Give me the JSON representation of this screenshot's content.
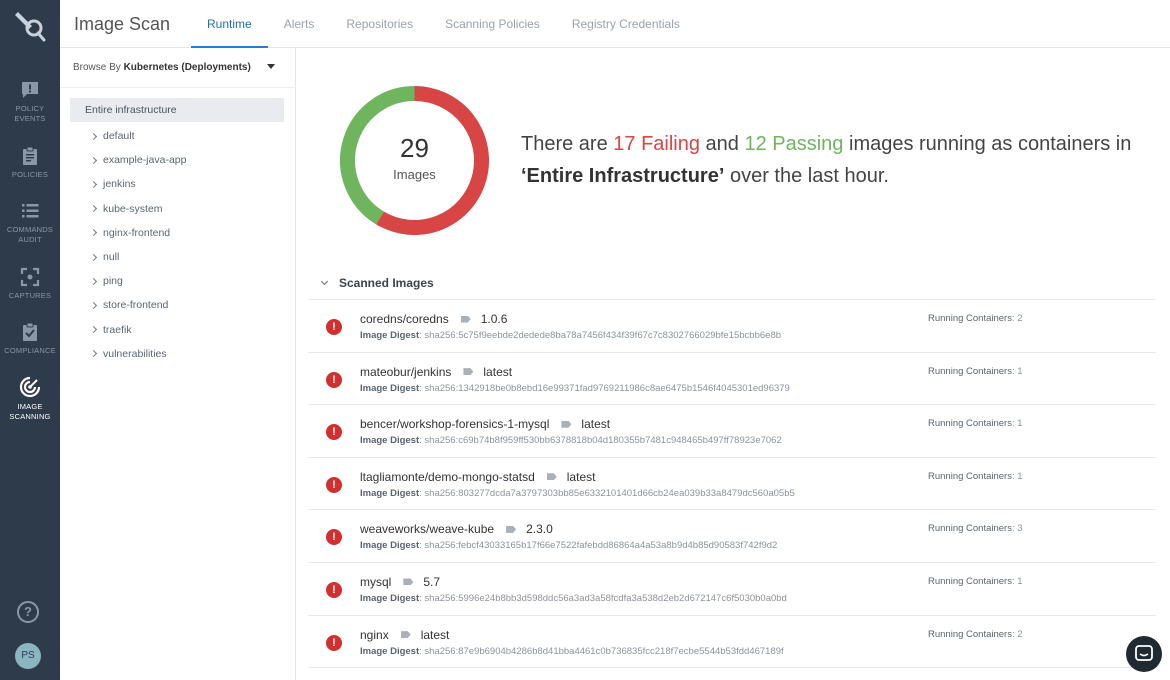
{
  "header": {
    "title": "Image Scan",
    "tabs": [
      "Runtime",
      "Alerts",
      "Repositories",
      "Scanning Policies",
      "Registry Credentials"
    ]
  },
  "leftnav": {
    "items": [
      {
        "label1": "POLICY",
        "label2": "EVENTS",
        "icon": "message-alert-icon"
      },
      {
        "label1": "POLICIES",
        "label2": "",
        "icon": "clipboard-icon"
      },
      {
        "label1": "COMMANDS",
        "label2": "AUDIT",
        "icon": "list-icon"
      },
      {
        "label1": "CAPTURES",
        "label2": "",
        "icon": "capture-frame-icon"
      },
      {
        "label1": "COMPLIANCE",
        "label2": "",
        "icon": "clipboard-check-icon"
      },
      {
        "label1": "IMAGE",
        "label2": "SCANNING",
        "icon": "scan-target-icon"
      }
    ],
    "help": "?",
    "avatar": "PS"
  },
  "tree": {
    "browse_prefix": "Browse By",
    "browse_value": "Kubernetes (Deployments)",
    "root": "Entire infrastructure",
    "items": [
      "default",
      "example-java-app",
      "jenkins",
      "kube-system",
      "nginx-frontend",
      "null",
      "ping",
      "store-frontend",
      "traefik",
      "vulnerabilities"
    ]
  },
  "summary": {
    "total": "29",
    "total_label": "Images",
    "failing": 17,
    "passing": 12,
    "t1": "There are ",
    "failing_text": "17 Failing",
    "t2": " and ",
    "passing_text": "12 Passing",
    "t3": " images running as containers in ",
    "scope": "‘Entire Infrastructure’",
    "t4": " over the last hour.",
    "colors": {
      "failing": "#d84545",
      "passing": "#6fb55e"
    }
  },
  "scanned": {
    "title": "Scanned Images",
    "digest_label": "Image Digest",
    "running_label": "Running Containers",
    "rows": [
      {
        "name": "coredns/coredns",
        "tag": "1.0.6",
        "digest": ": sha256:5c75f9eebde2dedede8ba78a7456f434f39f67c7c8302766029bfe15bcbb6e8b",
        "running": ": 2"
      },
      {
        "name": "mateobur/jenkins",
        "tag": "latest",
        "digest": ": sha256:1342918be0b8ebd16e99371fad9769211986c8ae6475b1546f4045301ed96379",
        "running": ": 1"
      },
      {
        "name": "bencer/workshop-forensics-1-mysql",
        "tag": "latest",
        "digest": ": sha256:c69b74b8f959ff530bb6378818b04d180355b7481c948465b497ff78923e7062",
        "running": ": 1"
      },
      {
        "name": "ltagliamonte/demo-mongo-statsd",
        "tag": "latest",
        "digest": ": sha256:803277dcda7a3797303bb85e6332101401d66cb24ea039b33a8479dc560a05b5",
        "running": ": 1"
      },
      {
        "name": "weaveworks/weave-kube",
        "tag": "2.3.0",
        "digest": ": sha256:febcf43033165b17f66e7522fafebdd86864a4a53a8b9d4b85d90583f742f9d2",
        "running": ": 3"
      },
      {
        "name": "mysql",
        "tag": "5.7",
        "digest": ": sha256:5996e24b8bb3d598ddc56a3ad3a58fcdfa3a538d2eb2d672147c6f5030b0a0bd",
        "running": ": 1"
      },
      {
        "name": "nginx",
        "tag": "latest",
        "digest": ": sha256:87e9b6904b4286b8d41bba4461c0b736835fcc218f7ecbe5544b53fdd467189f",
        "running": ": 2"
      }
    ]
  }
}
